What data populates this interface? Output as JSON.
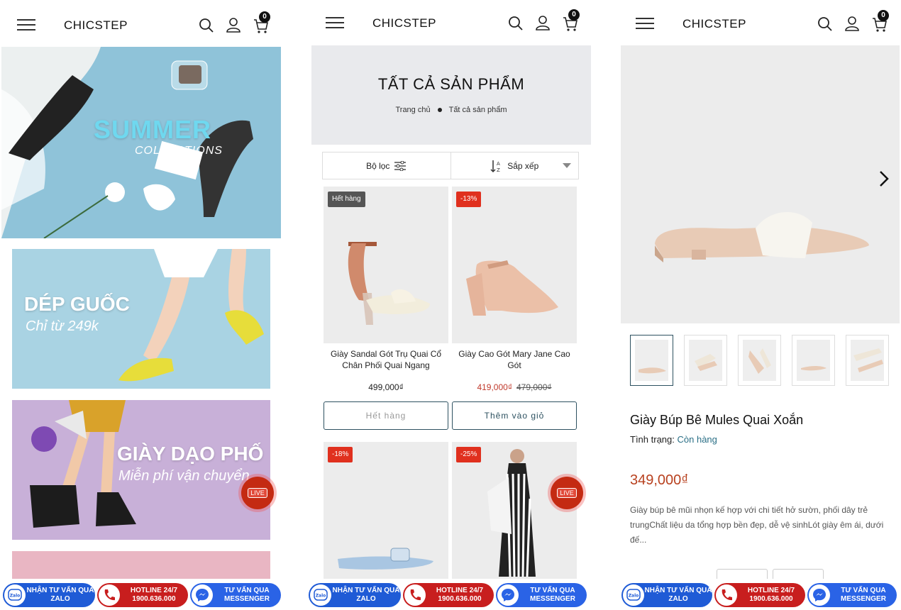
{
  "brand": "CHICSTEP",
  "cart_count": "0",
  "contact_bar": {
    "zalo": "NHẬN TƯ VẤN QUA ZALO",
    "hotline_label": "HOTLINE 24/7",
    "hotline_number": "1900.636.000",
    "messenger": "TƯ VẤN QUA MESSENGER",
    "zalo_icon_text": "Zalo"
  },
  "home": {
    "banners": [
      {
        "title": "SUMMER",
        "subtitle": "COLLECTIONS"
      },
      {
        "title": "DÉP GUỐC",
        "subtitle": "Chỉ từ 249k"
      },
      {
        "title": "GIÀY DẠO PHỐ",
        "subtitle": "Miễn phí vận chuyển"
      }
    ],
    "live_label": "LIVE"
  },
  "listing": {
    "title": "TẤT CẢ SẢN PHẨM",
    "breadcrumb": [
      "Trang chủ",
      "Tất cả sản phẩm"
    ],
    "filter_label": "Bộ lọc",
    "sort_label": "Sắp xếp",
    "products": [
      {
        "badge": "Hết hàng",
        "name": "Giày Sandal Gót Trụ Quai Cổ Chân Phối Quai Ngang",
        "price": "499,000₫",
        "old_price": "",
        "button": "Hết hàng"
      },
      {
        "badge": "-13%",
        "name": "Giày Cao Gót Mary Jane Cao Gót",
        "price": "419,000₫",
        "old_price": "479,000₫",
        "button": "Thêm vào giỏ"
      },
      {
        "badge": "-18%"
      },
      {
        "badge": "-25%"
      }
    ],
    "live_label": "LIVE"
  },
  "detail": {
    "name": "Giày Búp Bê Mules Quai Xoắn",
    "status_label": "Tình trạng:",
    "status_value": "Còn hàng",
    "price": "349,000₫",
    "description": "Giày búp bê mũi nhọn kế hợp với chi tiết hở sườn, phối dây trẻ trungChất liệu da tổng hợp bền đẹp, dễ vệ sinhLót giày êm ái, dưới đế...",
    "thumbnail_count": 5
  },
  "colors": {
    "accent": "#2d5160",
    "sale": "#c0392b",
    "zalo": "#1f5bd6",
    "hotline": "#c81e1e",
    "messenger": "#2a63e6"
  }
}
